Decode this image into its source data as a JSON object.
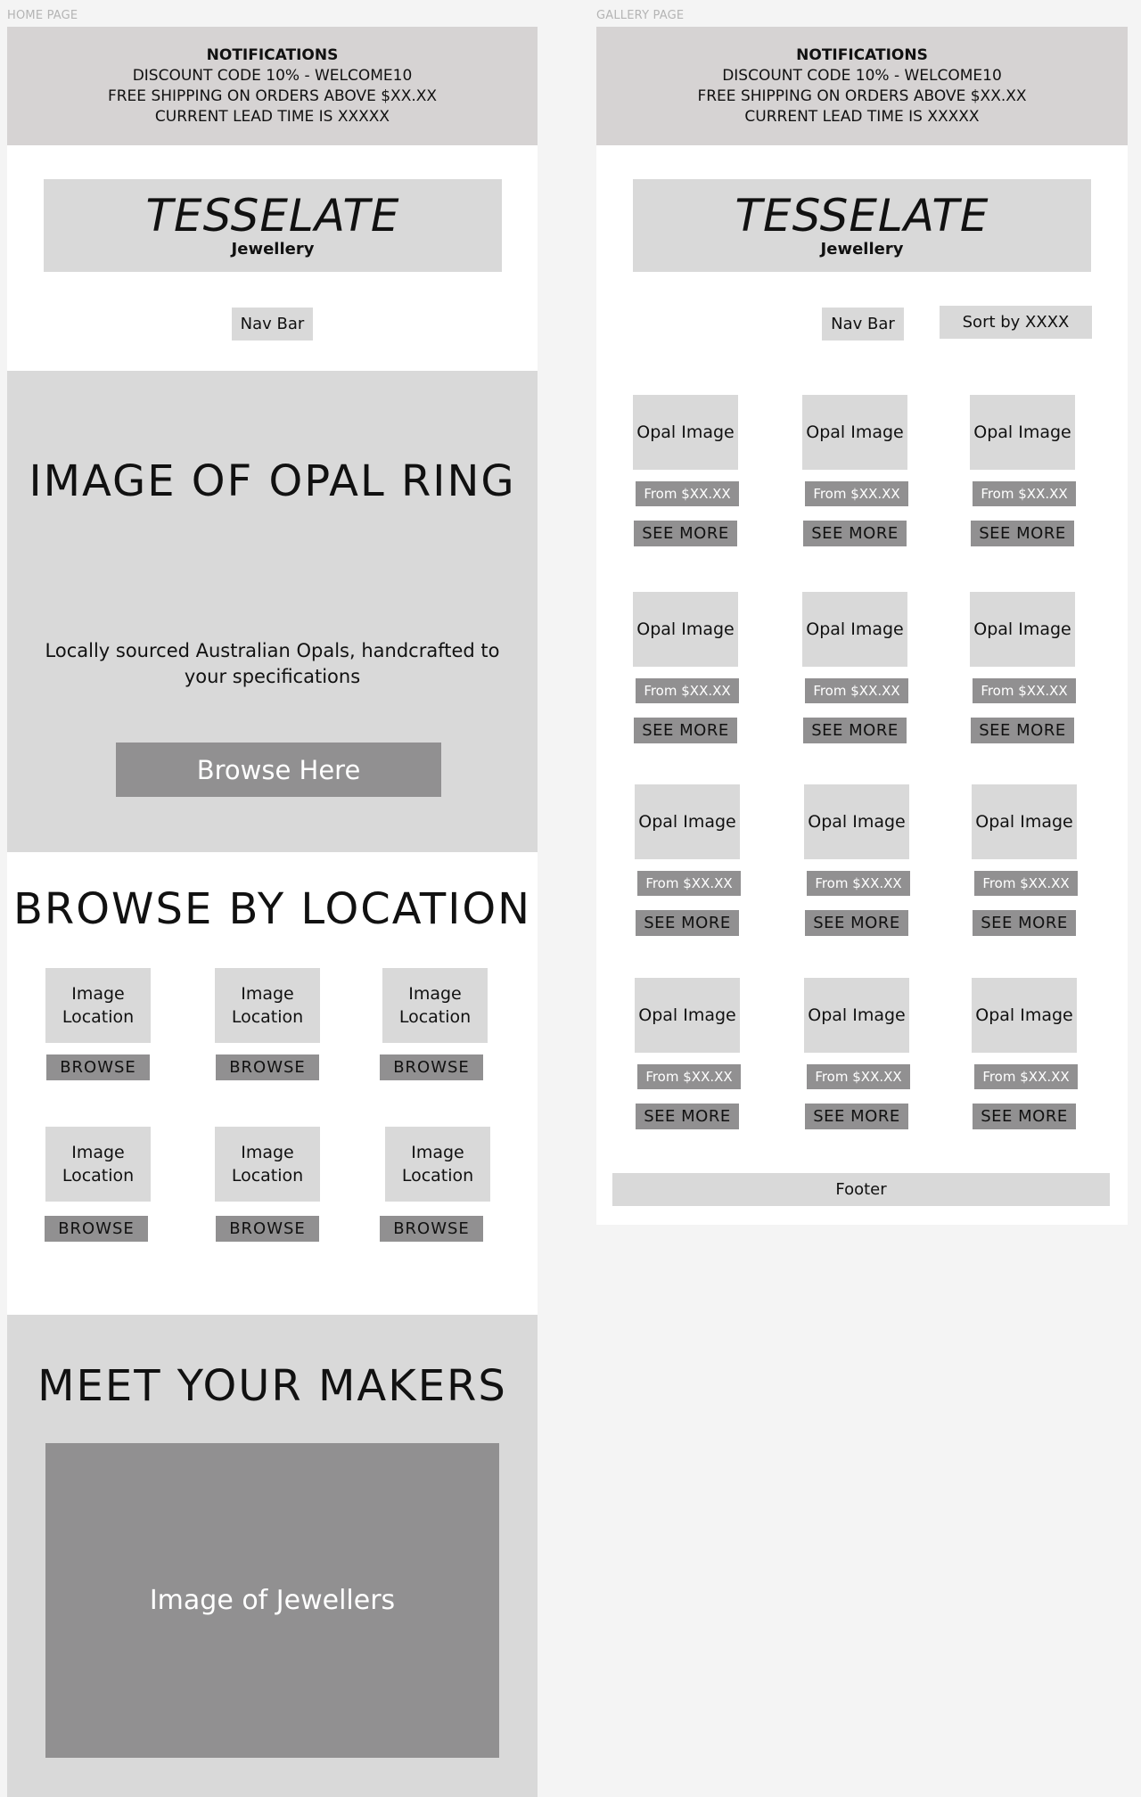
{
  "captions": {
    "home": "HOME PAGE",
    "gallery": "GALLERY PAGE"
  },
  "notifications": {
    "title": "NOTIFICATIONS",
    "lines": [
      "DISCOUNT CODE 10% - WELCOME10",
      "FREE SHIPPING ON ORDERS ABOVE $XX.XX",
      "CURRENT LEAD TIME IS XXXXX"
    ]
  },
  "brand": {
    "name": "TESSELATE",
    "sub": "Jewellery"
  },
  "nav": {
    "label": "Nav Bar"
  },
  "hero": {
    "title": "IMAGE OF OPAL RING",
    "text": "Locally sourced Australian Opals, handcrafted to your specifications",
    "button": "Browse Here"
  },
  "locations": {
    "title": "BROWSE BY LOCATION",
    "items": [
      {
        "image": "Image Location",
        "button": "BROWSE"
      },
      {
        "image": "Image Location",
        "button": "BROWSE"
      },
      {
        "image": "Image Location",
        "button": "BROWSE"
      },
      {
        "image": "Image Location",
        "button": "BROWSE"
      },
      {
        "image": "Image Location",
        "button": "BROWSE"
      },
      {
        "image": "Image Location",
        "button": "BROWSE"
      }
    ]
  },
  "makers": {
    "title": "MEET YOUR MAKERS",
    "image": "Image of Jewellers"
  },
  "gallery": {
    "sort": "Sort by XXXX",
    "products": [
      {
        "image": "Opal Image",
        "price": "From $XX.XX",
        "button": "SEE MORE"
      },
      {
        "image": "Opal Image",
        "price": "From $XX.XX",
        "button": "SEE MORE"
      },
      {
        "image": "Opal Image",
        "price": "From $XX.XX",
        "button": "SEE MORE"
      },
      {
        "image": "Opal Image",
        "price": "From $XX.XX",
        "button": "SEE MORE"
      },
      {
        "image": "Opal Image",
        "price": "From $XX.XX",
        "button": "SEE MORE"
      },
      {
        "image": "Opal Image",
        "price": "From $XX.XX",
        "button": "SEE MORE"
      },
      {
        "image": "Opal Image",
        "price": "From $XX.XX",
        "button": "SEE MORE"
      },
      {
        "image": "Opal Image",
        "price": "From $XX.XX",
        "button": "SEE MORE"
      },
      {
        "image": "Opal Image",
        "price": "From $XX.XX",
        "button": "SEE MORE"
      },
      {
        "image": "Opal Image",
        "price": "From $XX.XX",
        "button": "SEE MORE"
      },
      {
        "image": "Opal Image",
        "price": "From $XX.XX",
        "button": "SEE MORE"
      },
      {
        "image": "Opal Image",
        "price": "From $XX.XX",
        "button": "SEE MORE"
      }
    ],
    "footer": "Footer"
  }
}
